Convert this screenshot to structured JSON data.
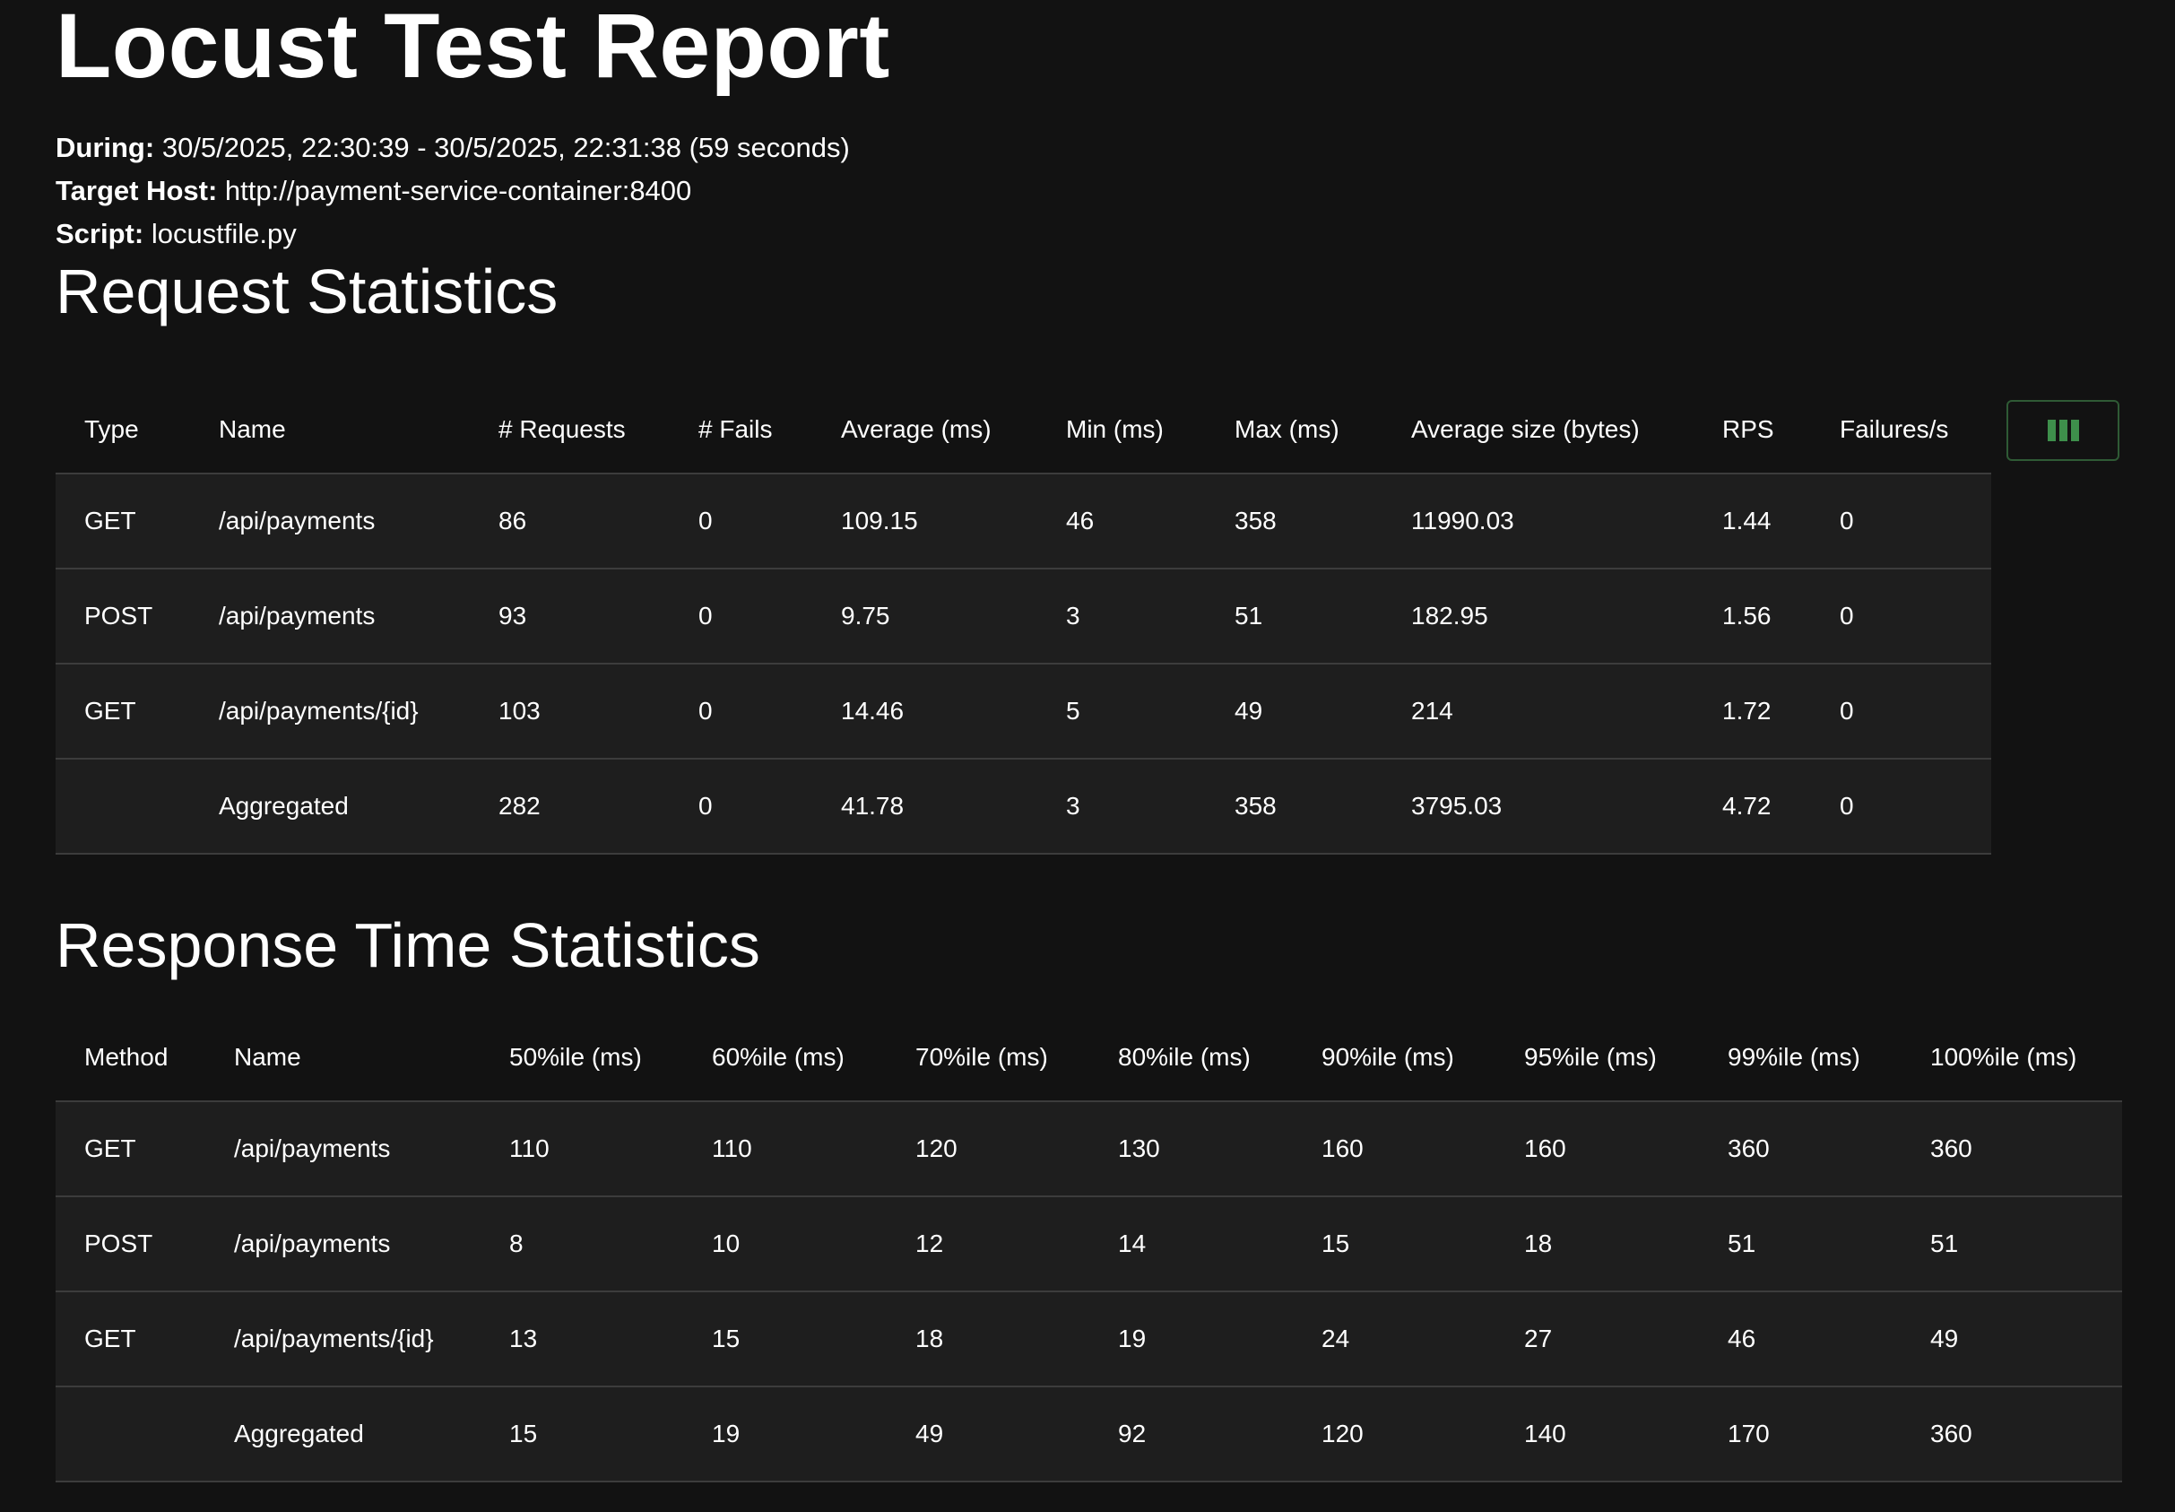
{
  "header": {
    "title": "Locust Test Report",
    "during_label": "During:",
    "during_value": "30/5/2025, 22:30:39 - 30/5/2025, 22:31:38 (59 seconds)",
    "host_label": "Target Host:",
    "host_value": "http://payment-service-container:8400",
    "script_label": "Script:",
    "script_value": "locustfile.py"
  },
  "request_stats": {
    "title": "Request Statistics",
    "columns": [
      "Type",
      "Name",
      "# Requests",
      "# Fails",
      "Average (ms)",
      "Min (ms)",
      "Max (ms)",
      "Average size (bytes)",
      "RPS",
      "Failures/s"
    ],
    "rows": [
      [
        "GET",
        "/api/payments",
        "86",
        "0",
        "109.15",
        "46",
        "358",
        "11990.03",
        "1.44",
        "0"
      ],
      [
        "POST",
        "/api/payments",
        "93",
        "0",
        "9.75",
        "3",
        "51",
        "182.95",
        "1.56",
        "0"
      ],
      [
        "GET",
        "/api/payments/{id}",
        "103",
        "0",
        "14.46",
        "5",
        "49",
        "214",
        "1.72",
        "0"
      ],
      [
        "",
        "Aggregated",
        "282",
        "0",
        "41.78",
        "3",
        "358",
        "3795.03",
        "4.72",
        "0"
      ]
    ],
    "column_toggle_icon": "columns-icon",
    "accent_color": "#3e8f4b"
  },
  "response_stats": {
    "title": "Response Time Statistics",
    "columns": [
      "Method",
      "Name",
      "50%ile (ms)",
      "60%ile (ms)",
      "70%ile (ms)",
      "80%ile (ms)",
      "90%ile (ms)",
      "95%ile (ms)",
      "99%ile (ms)",
      "100%ile (ms)"
    ],
    "rows": [
      [
        "GET",
        "/api/payments",
        "110",
        "110",
        "120",
        "130",
        "160",
        "160",
        "360",
        "360"
      ],
      [
        "POST",
        "/api/payments",
        "8",
        "10",
        "12",
        "14",
        "15",
        "18",
        "51",
        "51"
      ],
      [
        "GET",
        "/api/payments/{id}",
        "13",
        "15",
        "18",
        "19",
        "24",
        "27",
        "46",
        "49"
      ],
      [
        "",
        "Aggregated",
        "15",
        "19",
        "49",
        "92",
        "120",
        "140",
        "170",
        "360"
      ]
    ]
  }
}
